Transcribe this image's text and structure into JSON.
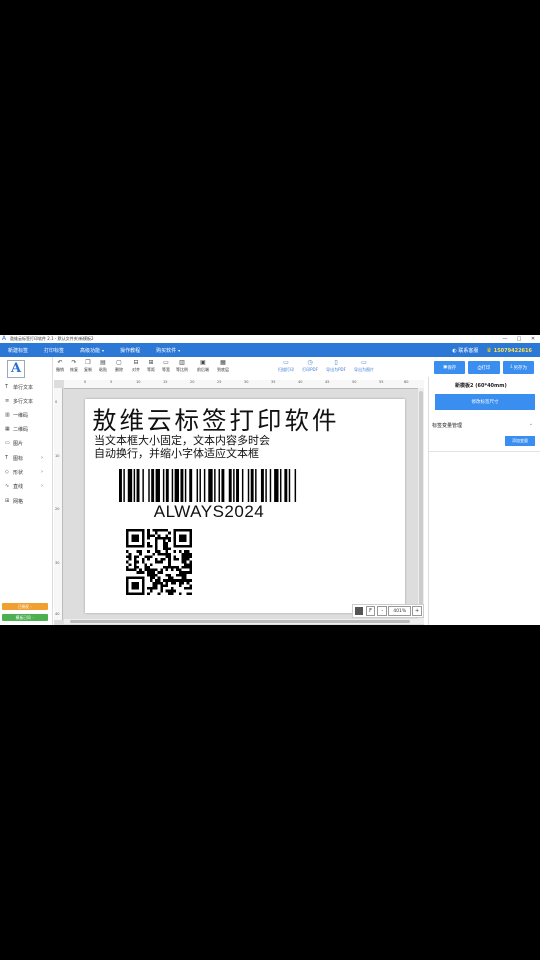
{
  "window": {
    "title": "敖维云标签打印软件 2.1 - 默认文件夹\\新模板2",
    "minimize": "—",
    "maximize": "□",
    "close": "✕"
  },
  "menubar": {
    "items": [
      {
        "label": "新建标签",
        "chevron": ""
      },
      {
        "label": "打印标签",
        "chevron": ""
      },
      {
        "label": "高级功能",
        "chevron": "▾"
      },
      {
        "label": "操作教程",
        "chevron": ""
      },
      {
        "label": "购买软件",
        "chevron": "▾"
      }
    ],
    "service": "联系客服",
    "phone": "15079422616"
  },
  "toolbar": {
    "items": [
      "撤销",
      "恢复",
      "复制",
      "粘贴",
      "删除",
      "对齐",
      "等距",
      "等宽",
      "置顶",
      "置底",
      "图层"
    ],
    "view_items": [
      "对齐",
      "等距",
      "等宽",
      "置底",
      "等比例",
      "前后端",
      "到底层"
    ],
    "right_items": [
      "扫描打印",
      "打印PDF",
      "导出为PDF",
      "导出为图片"
    ]
  },
  "actions": {
    "save": "保存",
    "print": "打印",
    "save_as": "另存为"
  },
  "leftpanel": {
    "logo": "A",
    "tools": [
      {
        "label": "单行文本",
        "icon": "T",
        "arrow": ""
      },
      {
        "label": "多行文本",
        "icon": "≡",
        "arrow": ""
      },
      {
        "label": "一维码",
        "icon": "▥",
        "arrow": ""
      },
      {
        "label": "二维码",
        "icon": "▦",
        "arrow": ""
      },
      {
        "label": "图片",
        "icon": "▭",
        "arrow": ""
      },
      {
        "label": "图标",
        "icon": "T",
        "arrow": "›"
      },
      {
        "label": "形状",
        "icon": "◇",
        "arrow": "›"
      },
      {
        "label": "直线",
        "icon": "∿",
        "arrow": "›"
      },
      {
        "label": "网格",
        "icon": "⊞",
        "arrow": ""
      }
    ],
    "badge_orange": "已授权 ◦",
    "badge_green": "模板已同 ◦"
  },
  "rulers": {
    "h_ticks": [
      "0",
      "5",
      "10",
      "15",
      "20",
      "25",
      "30",
      "35",
      "40",
      "45",
      "50",
      "55",
      "60"
    ],
    "v_ticks": [
      "0",
      "10",
      "20",
      "30",
      "40"
    ]
  },
  "label": {
    "title": "敖维云标签打印软件",
    "line1": "当文本框大小固定，文本内容多时会",
    "line2": "自动换行，并缩小字体适应文本框",
    "barcode_text": "ALWAYS2024"
  },
  "zoom": {
    "font_btn": "F",
    "minus": "-",
    "value": "401%",
    "plus": "+"
  },
  "rightpanel": {
    "template_name": "新模板2 (60*40mm)",
    "size_button": "修改标签尺寸",
    "var_header": "标签变量管理",
    "var_chevron": "⌄",
    "add_var": "添加变量"
  },
  "colors": {
    "accent": "#2b78d6",
    "button": "#3a8ef0",
    "phone": "#ffe14d",
    "badge_orange": "#f0a030",
    "badge_green": "#4caf50"
  }
}
